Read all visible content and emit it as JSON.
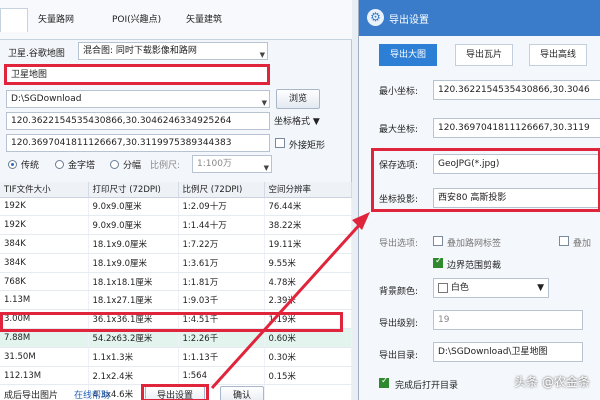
{
  "left": {
    "tabs": [
      "矢量路网",
      "POI(兴趣点)",
      "矢量建筑"
    ],
    "map_source": "卫星.谷歌地图",
    "mixed_select": "混合图: 同时下载影像和路网",
    "task_name": "卫星地图",
    "save_path": "D:\\SGDownload",
    "browse_btn": "浏览",
    "coord1": "120.3622154535430866,30.3046246334925264",
    "coord_format": "坐标格式",
    "coord2": "120.3697041811126667,30.3119975389344383",
    "outer_rect": "外接矩形",
    "radio_opts": [
      "传统",
      "金字塔",
      "分幅"
    ],
    "scale_label": "比例尺:",
    "scale_value": "1:100万",
    "table": {
      "headers": [
        "TIF文件大小",
        "打印尺寸 (72DPI)",
        "比例尺 (72DPI)",
        "空间分辨率"
      ],
      "rows": [
        [
          "192K",
          "9.0x9.0厘米",
          "1:2.09十万",
          "76.44米"
        ],
        [
          "192K",
          "9.0x9.0厘米",
          "1:1.44十万",
          "38.22米"
        ],
        [
          "384K",
          "18.1x9.0厘米",
          "1:7.22万",
          "19.11米"
        ],
        [
          "384K",
          "18.1x9.0厘米",
          "1:3.61万",
          "9.55米"
        ],
        [
          "768K",
          "18.1x18.1厘米",
          "1:1.81万",
          "4.78米"
        ],
        [
          "1.13M",
          "18.1x27.1厘米",
          "1:9.03千",
          "2.39米"
        ],
        [
          "3.00M",
          "36.1x36.1厘米",
          "1:4.51千",
          "1.19米"
        ],
        [
          "7.88M",
          "54.2x63.2厘米",
          "1:2.26千",
          "0.60米"
        ],
        [
          "31.50M",
          "1.1x1.3米",
          "1:1.13千",
          "0.30米"
        ],
        [
          "112.13M",
          "2.1x2.4米",
          "1:564",
          "0.15米"
        ],
        [
          "",
          "4.3x4.6米",
          "",
          ""
        ]
      ]
    },
    "bottom_text": "成后导出图片",
    "online_help": "在线帮助",
    "export_btn": "导出设置",
    "ok_btn": "确认"
  },
  "dialog": {
    "title": "导出设置",
    "tabs": [
      "导出大图",
      "导出瓦片",
      "导出高线"
    ],
    "min_coord_label": "最小坐标:",
    "min_coord_value": "120.3622154535430866,30.3046",
    "max_coord_label": "最大坐标:",
    "max_coord_value": "120.3697041811126667,30.3119",
    "save_option_label": "保存选项:",
    "save_option_value": "GeoJPG(*.jpg)",
    "projection_label": "坐标投影:",
    "projection_value": "西安80 高斯投影",
    "export_option_label": "导出选项:",
    "overlay_road": "叠加路网标签",
    "overlay_more": "叠加",
    "boundary_clip": "边界范围剪裁",
    "bg_color_label": "背景颜色:",
    "bg_color_value": "白色",
    "level_label": "导出级别:",
    "level_value": "19",
    "dir_label": "导出目录:",
    "dir_value": "D:\\SGDownload\\卫星地图",
    "open_dir_after": "完成后打开目录",
    "watermark": "头条 @农金条"
  },
  "colors": {
    "highlight": "#e0243b",
    "title_bar": "#3a7cc9",
    "active_tab": "#2d7fd6"
  }
}
